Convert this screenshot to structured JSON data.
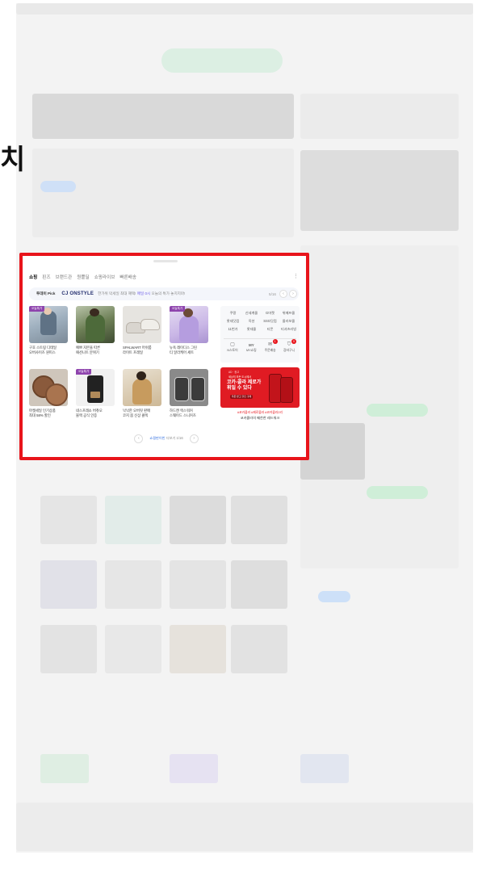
{
  "side_text": "치",
  "widget": {
    "tabs": [
      "쇼핑",
      "핀즈",
      "브랜드관",
      "원쁠딜",
      "쇼핑라이브",
      "빠른배송"
    ],
    "banner": {
      "pick_label": "투데이 Pick",
      "brand": "CJ ONSTYLE",
      "desc_pre": "한가위 막세일 최대 혜택! ",
      "desc_highlight": "매일 0시",
      "desc_post": " 오늘의 특가 놓치지마!",
      "page": "5/16",
      "prev_icon": "‹",
      "next_icon": "›"
    },
    "products": [
      {
        "badge": "오늘특가",
        "name_line1": "구호 스트링 디테일",
        "name_line2": "오버사이즈 원피스"
      },
      {
        "badge": "",
        "name_line1": "예쁘 자본을 따른",
        "name_line2": "패션니트 분위기"
      },
      {
        "badge": "",
        "name_line1": "SPALWART 머쉬룸",
        "name_line2": "라이트 프레일"
      },
      {
        "badge": "오늘특가",
        "name_line1": "뉴욕 레이디스 그린",
        "name_line2": "티 알라케어 세트"
      },
      {
        "badge": "",
        "name_line1": "마켓세일 인기상품",
        "name_line2": "최대 58% 할인"
      },
      {
        "badge": "오늘특가",
        "name_line1": "네스프레소 버츄오",
        "name_line2": "블랙 공식 인증"
      },
      {
        "badge": "",
        "name_line1": "낙낙한 오버핏 판매",
        "name_line2": "코지 봄 신상 콜렉"
      },
      {
        "badge": "",
        "name_line1": "하드캔 렉스워커",
        "name_line2": "스웨이드 스니커즈"
      }
    ],
    "menu": {
      "items": [
        "쿠팡",
        "신세계몰",
        "G마켓",
        "위메프몰",
        "롯데닷컴",
        "옥션",
        "SSG닷컴",
        "몰라보몰",
        "11번가",
        "롯데몰",
        "티몬",
        "티셔츠리빙"
      ],
      "shortcuts": [
        {
          "icon": "▢",
          "label": "N스토어",
          "badge": ""
        },
        {
          "icon": "MY",
          "label": "MY쇼핑",
          "badge": ""
        },
        {
          "icon": "✉",
          "label": "주문배송",
          "badge": "1"
        },
        {
          "icon": "⛉",
          "label": "장바구니",
          "badge": "0"
        }
      ]
    },
    "ad": {
      "small_label": "AD · 광고",
      "sub": "세상의 모든 도시에서",
      "headline": "코카-콜라 제로가 휘일 수 있다",
      "cta": "쿠폰 받고 할인 구매",
      "tags": "#코카콜라 #제로콜라 #코카콜라2리",
      "desc": "코카콜라의 째찬한 레드워크"
    },
    "pager": {
      "prev_icon": "‹",
      "next_icon": "›",
      "label_accent": "쇼핑판이빈",
      "label_rest": " 더보기 1/16"
    }
  },
  "colors": {
    "highlight_border": "#e8141b",
    "accent_blue": "#2d6cdf",
    "brand_navy": "#1f2a6b",
    "badge_purple": "#8e44ad"
  }
}
